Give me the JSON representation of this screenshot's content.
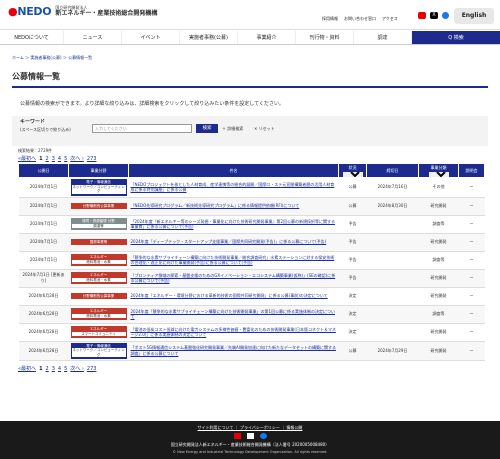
{
  "header": {
    "org_small": "国立研究開発法人",
    "org_name": "新エネルギー・産業技術総合開発機構",
    "logo": "NEDO",
    "links": [
      "採用情報",
      "お問い合わせ窓口",
      "アクセス"
    ],
    "english": "English"
  },
  "nav": {
    "items": [
      "NEDOについて",
      "ニュース",
      "イベント",
      "実施者事務(公募)",
      "事業紹介",
      "刊行物・資料",
      "調達"
    ],
    "search": "Q 検索"
  },
  "breadcrumb": "ホーム ＞ 実施者事務(公募) ＞ 公募情報一覧",
  "title": "公募情報一覧",
  "intro": "公募情報の検索ができます。より詳細な絞り込みは、詳細検索をクリックして絞り込みたい条件を設定してください。",
  "keyword": {
    "title": "キーワード",
    "sub": "(スペース区切りで絞り込み)",
    "placeholder": "入力してください",
    "search": "検索",
    "detail": "＋ 詳細検索",
    "reset": "✕ リセット"
  },
  "count": "検索結果：2729件",
  "pager": {
    "first": "«最初へ",
    "prev": "‹ 前へ",
    "pages": [
      "1",
      "2",
      "3",
      "4",
      "5"
    ],
    "next": "次へ ›",
    "last": "273"
  },
  "table": {
    "headers": [
      "公開日",
      "事業分野",
      "件名",
      "状況",
      "締切日",
      "事業分類",
      "説明会"
    ],
    "select_label": "すべて"
  },
  "rows": [
    {
      "date": "2024年7月1日",
      "cat1": "電子・情報通信",
      "cat2": "ネットワーク／コンピューティング",
      "color": "#1d2b8e",
      "title": "「NEDOプロジェクトを核とした人材育成、産学連携等の総合的展開／国際ロ・ステ元宣間構築者層の活用人材育成に係る特別講座」に係る公募",
      "status": "公募",
      "deadline": "2024年7月16日",
      "type": "その他",
      "seminar": "ー"
    },
    {
      "date": "2024年7月1日",
      "cat1": "分野横断的公募事業",
      "cat2": "",
      "color": "#c0392b",
      "title": "「NEDO先導研究プログラム／新技術先導研究プログラム」に係る情報提供依頼(RFI)について",
      "status": "公募",
      "deadline": "2024年8月30日",
      "type": "研究開発",
      "seminar": "ー"
    },
    {
      "date": "2024年7月1日",
      "cat1": "環境・資源循環 分野",
      "cat2": "調達等",
      "color": "#7f8c8d",
      "title": "「2024年度『新エネルギー等のシーズ発掘・事業化に向けた技術研究開発事業』第2回公募の新規採択等に関する事業費」に係る公募について(予告)",
      "status": "予告",
      "deadline": "",
      "type": "調査等",
      "seminar": "ー"
    },
    {
      "date": "2024年7月1日",
      "cat1": "国際事業等",
      "cat2": "",
      "color": "#c0392b",
      "title": "2024年度「ディープテック・スタートアップ支援事業／国際共同研究開発(予告)」に係る公募について(予告)",
      "status": "予告",
      "deadline": "",
      "type": "研究開発",
      "seminar": "ー"
    },
    {
      "date": "2024年7月1日",
      "cat1": "エネルギー",
      "cat2": "燃料電池・水素",
      "color": "#c0392b",
      "title": "「競争的な水素サプライチェーン構築に向けた技術開発事業／総合調査研究」水素ステーションに対する保安技術の合理化・適正化に向けた事業開発(予告)に係る公募について(予告)",
      "status": "予告",
      "deadline": "",
      "type": "調査等",
      "seminar": "ー"
    },
    {
      "date": "2024年7月1日 [更新あり]",
      "cat1": "エネルギー",
      "cat2": "燃料電池・水素",
      "color": "#c0392b",
      "title": "「プロンティア領域の探索・基盤支援のためのGXイノベーション・エコシステム構築事業(仮称)」(SEの確認)に係る公募について(予告)",
      "status": "予告",
      "deadline": "",
      "type": "研究開発",
      "seminar": "ー"
    },
    {
      "date": "2024年6月28日",
      "cat1": "分野横断的公募事業",
      "cat2": "",
      "color": "#c0392b",
      "title": "2024年度「エネルギー・環境分野における革新的技術の国際共同研究開発」に係る公募(事前)の決定について",
      "status": "決定",
      "deadline": "",
      "type": "研究開発",
      "seminar": "ー"
    },
    {
      "date": "2024年6月28日",
      "cat1": "エネルギー",
      "cat2": "燃料電池・水素",
      "color": "#c0392b",
      "title": "2024年度「競争的な水素サプライチェーン構築に向けた技術開発事業」の第1回公募に係る実施体制の決定について",
      "status": "決定",
      "deadline": "",
      "type": "調査等",
      "seminar": "ー"
    },
    {
      "date": "2024年6月28日",
      "cat1": "エネルギー",
      "cat2": "スマートコミュニティ",
      "color": "#c0392b",
      "title": "「電池の低炭コスト低減に向けた電力システムの多様性価値・豊富化のための技術開発事業(日本版コネクト＆マネージ2.0)」に係る実施体制の決定について",
      "status": "決定",
      "deadline": "",
      "type": "研究開発",
      "seminar": "ー"
    },
    {
      "date": "2024年6月28日",
      "cat1": "電子・情報通信",
      "cat2": "ネットワーク／コンピューティング",
      "color": "#1d2b8e",
      "title": "「ポスト5G情報通信システム基盤強化研究開発事業／先端AI開発加速に向けた新たなデータセットの構築に関する調査」に係る公募について",
      "status": "公募",
      "deadline": "2024年7月29日",
      "type": "研究開発",
      "seminar": "ー"
    }
  ],
  "footer": {
    "links": "サイト利用について ｜ プライバシーポリシー ｜ 情報公開",
    "org": "国立研究開発法人新エネルギー・産業技術総合開発機構（法人番号 2020005008480）",
    "copyright": "© New Energy and Industrial Technology Development Organization. All rights reserved."
  }
}
